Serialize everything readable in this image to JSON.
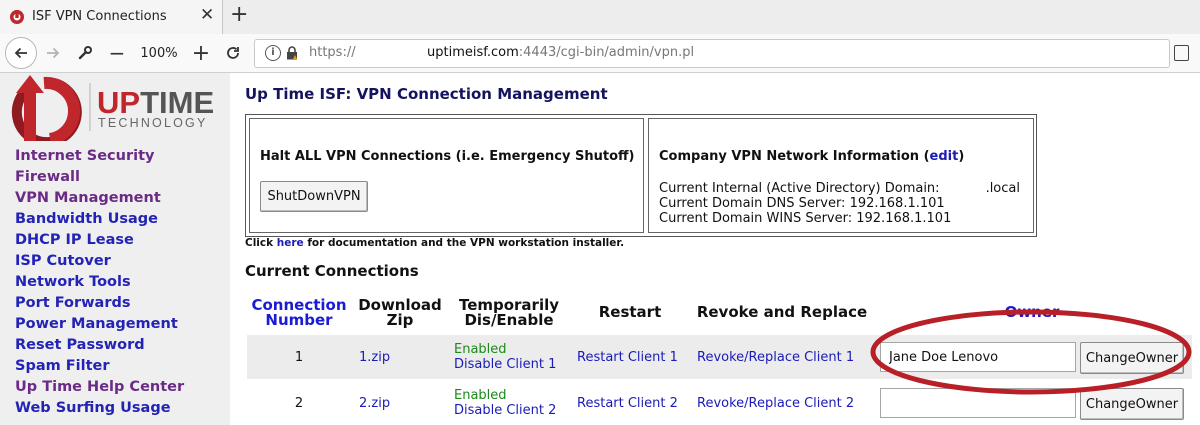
{
  "browser": {
    "tab_title": "ISF VPN Connections",
    "zoom": "100%",
    "url_scheme": "https://",
    "url_domain": "uptimeisf.com",
    "url_path": ":4443/cgi-bin/admin/vpn.pl"
  },
  "brand": {
    "name": "UPTIME",
    "sub": "TECHNOLOGY",
    "color": "#c0272d"
  },
  "sidebar": {
    "items": [
      {
        "label": "Internet Security",
        "visited": true
      },
      {
        "label": "Firewall",
        "visited": true
      },
      {
        "label": "VPN Management",
        "visited": true
      },
      {
        "label": "Bandwidth Usage",
        "visited": false
      },
      {
        "label": "DHCP IP Lease",
        "visited": false
      },
      {
        "label": "ISP Cutover",
        "visited": false
      },
      {
        "label": "Network Tools",
        "visited": false
      },
      {
        "label": "Port Forwards",
        "visited": false
      },
      {
        "label": "Power Management",
        "visited": false
      },
      {
        "label": "Reset Password",
        "visited": false
      },
      {
        "label": "Spam Filter",
        "visited": false
      },
      {
        "label": "Up Time Help Center",
        "visited": true
      },
      {
        "label": "Web Surfing Usage",
        "visited": false
      }
    ]
  },
  "main": {
    "title": "Up Time ISF: VPN Connection Management",
    "halt": {
      "title": "Halt ALL VPN Connections (i.e. Emergency Shutoff)",
      "button": "ShutDownVPN"
    },
    "info": {
      "title": "Company VPN Network Information (",
      "edit": "edit",
      "title_end": ")",
      "domain_label": "Current Internal (Active Directory) Domain:",
      "domain_suffix": ".local",
      "dns": "Current Domain DNS Server: 192.168.1.101",
      "wins": "Current Domain WINS Server: 192.168.1.101"
    },
    "doc_note": {
      "pre": "Click ",
      "link": "here",
      "post": " for documentation and the VPN workstation installer."
    },
    "section": "Current Connections",
    "table": {
      "headers": {
        "conn_1": "Connection",
        "conn_2": "Number",
        "zip_1": "Download",
        "zip_2": "Zip",
        "toggle_1": "Temporarily",
        "toggle_2": "Dis/Enable",
        "restart": "Restart",
        "revoke": "Revoke and Replace",
        "owner": "Owner"
      },
      "rows": [
        {
          "number": "1",
          "zip": "1.zip",
          "status": "Enabled",
          "toggle": "Disable Client 1",
          "restart": "Restart Client 1",
          "revoke": "Revoke/Replace Client 1",
          "owner": "Jane Doe Lenovo",
          "button": "ChangeOwner"
        },
        {
          "number": "2",
          "zip": "2.zip",
          "status": "Enabled",
          "toggle": "Disable Client 2",
          "restart": "Restart Client 2",
          "revoke": "Revoke/Replace Client 2",
          "owner": "",
          "button": "ChangeOwner"
        }
      ]
    }
  }
}
